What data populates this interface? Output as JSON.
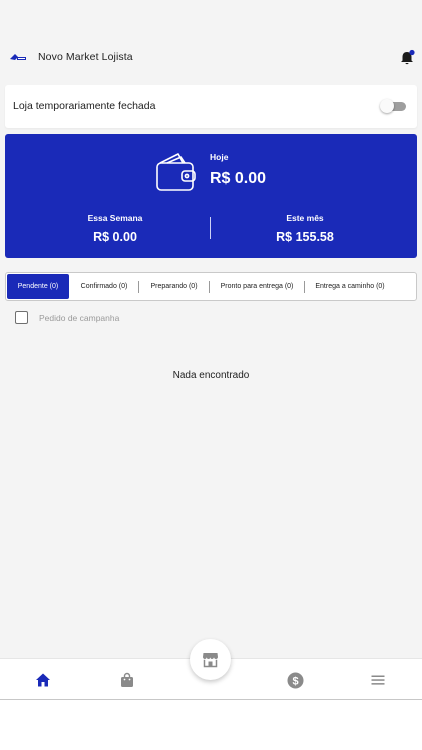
{
  "header": {
    "title": "Novo Market Lojista",
    "logo_icon": "novo-market-logo",
    "notification_icon": "bell-icon",
    "notification_dot_color": "#1a2ab8"
  },
  "store_status": {
    "label": "Loja temporariamente fechada",
    "toggle_on": false
  },
  "balance": {
    "accent_color": "#1a2ab8",
    "icon": "wallet-icon",
    "today_label": "Hoje",
    "today_value": "R$ 0.00",
    "week_label": "Essa Semana",
    "week_value": "R$ 0.00",
    "month_label": "Este mês",
    "month_value": "R$ 155.58"
  },
  "tabs": [
    {
      "label": "Pendente (0)",
      "active": true
    },
    {
      "label": "Confirmado (0)",
      "active": false
    },
    {
      "label": "Preparando (0)",
      "active": false
    },
    {
      "label": "Pronto para entrega (0)",
      "active": false
    },
    {
      "label": "Entrega a caminho (0)",
      "active": false
    }
  ],
  "filter": {
    "campaign_label": "Pedido de campanha",
    "checked": false
  },
  "empty_state": "Nada encontrado",
  "bottom_nav": {
    "items": [
      {
        "icon": "home-icon",
        "active": true
      },
      {
        "icon": "shopping-bag-icon",
        "active": false
      },
      {
        "icon": "store-icon",
        "active": false
      },
      {
        "icon": "dollar-icon",
        "active": false
      },
      {
        "icon": "menu-icon",
        "active": false
      }
    ],
    "active_color": "#1a2ab8",
    "inactive_color": "#8a8a8a"
  }
}
